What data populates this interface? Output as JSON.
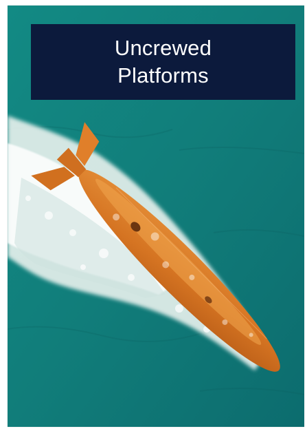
{
  "title": {
    "line1": "Uncrewed",
    "line2": "Platforms"
  },
  "colors": {
    "sea": "#127f7c",
    "sea_dark": "#0b6a6a",
    "title_bg": "#0c1a3c",
    "title_text": "#ffffff",
    "vehicle": "#d97b26",
    "foam": "#f3f7f4"
  },
  "image": {
    "subject": "orange uncrewed underwater vehicle moving through turquoise sea, top-down view"
  }
}
